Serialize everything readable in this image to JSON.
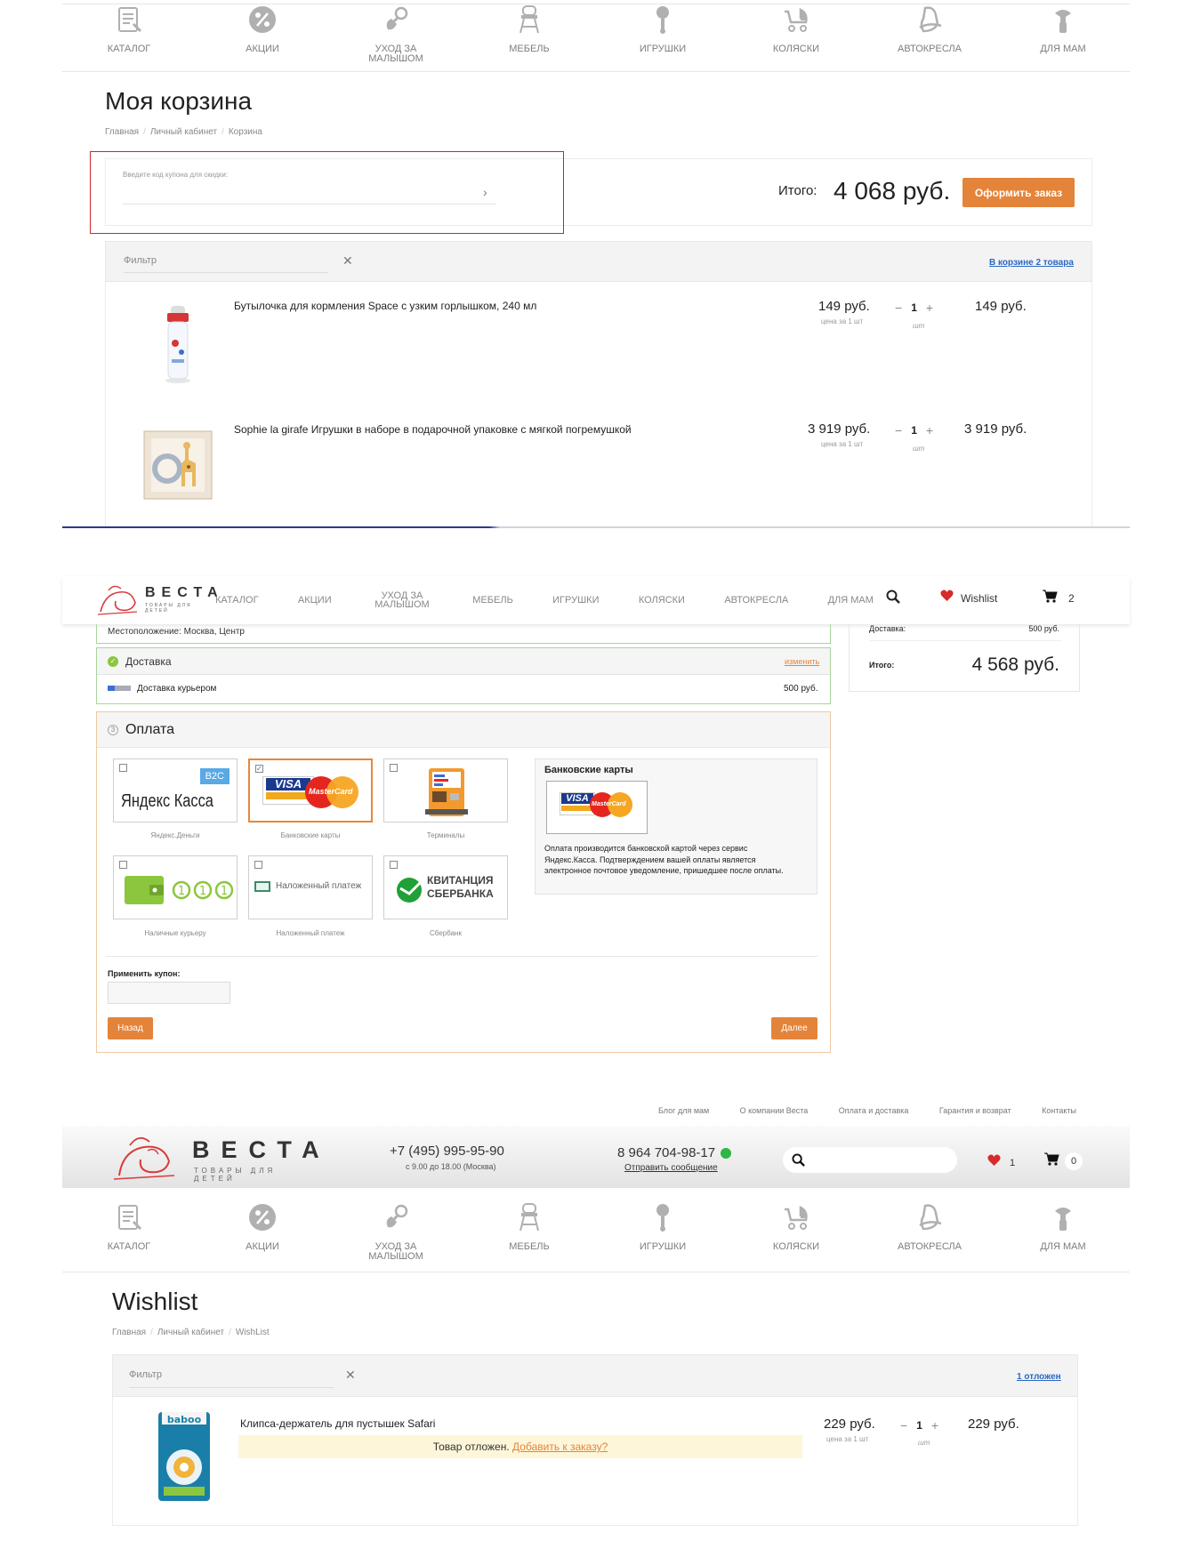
{
  "nav_categories": [
    {
      "label": "КАТАЛОГ",
      "icon": "catalog-icon"
    },
    {
      "label": "АКЦИИ",
      "icon": "percent-icon"
    },
    {
      "label": "УХОД ЗА МАЛЫШОМ",
      "icon": "pacifier-icon"
    },
    {
      "label": "МЕБЕЛЬ",
      "icon": "high-chair-icon"
    },
    {
      "label": "ИГРУШКИ",
      "icon": "rattle-icon"
    },
    {
      "label": "КОЛЯСКИ",
      "icon": "stroller-icon"
    },
    {
      "label": "АВТОКРЕСЛА",
      "icon": "car-seat-icon"
    },
    {
      "label": "ДЛЯ МАМ",
      "icon": "breast-pump-icon"
    }
  ],
  "cart": {
    "title": "Моя корзина",
    "breadcrumbs": [
      "Главная",
      "Личный кабинет",
      "Корзина"
    ],
    "coupon_placeholder": "Введите код купона для скидки:",
    "total_label": "Итого:",
    "total_value": "4 068 руб.",
    "checkout_button": "Оформить заказ",
    "filter_placeholder": "Фильтр",
    "items_count": "В корзине 2 товара",
    "items": [
      {
        "name": "Бутылочка для кормления Space с узким горлышком, 240 мл",
        "price": "149 руб.",
        "unit": "цена за 1 шт",
        "qty": "1",
        "qty_unit": "шт",
        "sum": "149 руб."
      },
      {
        "name": "Sophie la girafe Игрушки в наборе в подарочной упаковке с мягкой погремушкой",
        "price": "3 919 руб.",
        "unit": "цена за 1 шт",
        "qty": "1",
        "qty_unit": "шт",
        "sum": "3 919 руб."
      }
    ]
  },
  "sticky_header": {
    "logo_text": "ВЕСТА",
    "logo_sub": "ТОВАРЫ ДЛЯ ДЕТЕЙ",
    "menu": [
      "КАТАЛОГ",
      "АКЦИИ",
      "УХОД ЗА МАЛЫШОМ",
      "МЕБЕЛЬ",
      "ИГРУШКИ",
      "КОЛЯСКИ",
      "АВТОКРЕСЛА",
      "ДЛЯ МАМ"
    ],
    "wishlist": "Wishlist",
    "cart_count": "2"
  },
  "checkout": {
    "location": "Местоположение: Москва, Центр",
    "delivery_title": "Доставка",
    "change_link": "изменить",
    "delivery_method": "Доставка курьером",
    "delivery_price": "500 руб.",
    "payment_num": "3",
    "payment_title": "Оплата",
    "payment_methods": [
      {
        "caption": "Яндекс.Деньги",
        "logo": "Яндекс Касса",
        "badge": "B2C"
      },
      {
        "caption": "Банковские карты",
        "logo": "VISA MasterCard"
      },
      {
        "caption": "Терминалы",
        "logo": "terminal"
      },
      {
        "caption": "Наличные курьеру",
        "logo": "cash"
      },
      {
        "caption": "Наложенный платеж",
        "logo": "Наложенный платеж"
      },
      {
        "caption": "Сбербанк",
        "logo": "КВИТАНЦИЯ СБЕРБАНКА"
      }
    ],
    "info_title": "Банковские карты",
    "info_text": "Оплата производится банковской картой через сервис Яндекс.Касса. Подтверждением вашей оплаты является электронное почтовое уведомление, пришедшее после оплаты.",
    "coupon_label": "Применить купон:",
    "back_button": "Назад",
    "next_button": "Далее",
    "summary_delivery_label": "Доставка:",
    "summary_delivery_value": "500 руб.",
    "summary_total_label": "Итого:",
    "summary_total_value": "4 568 руб."
  },
  "site_header": {
    "top_links": [
      "Блог для мам",
      "О компании Веста",
      "Оплата и доставка",
      "Гарантия и возврат",
      "Контакты"
    ],
    "logo_text": "ВЕСТА",
    "logo_sub": "ТОВАРЫ ДЛЯ ДЕТЕЙ",
    "phone1": "+7 (495) 995-95-90",
    "phone1_hours": "с 9.00 до 18.00 (Москва)",
    "phone2": "8 964 704-98-17",
    "phone2_link": "Отправить сообщение",
    "wishlist_count": "1",
    "cart_count": "0"
  },
  "wishlist": {
    "title": "Wishlist",
    "breadcrumbs": [
      "Главная",
      "Личный кабинет",
      "WishList"
    ],
    "filter_placeholder": "Фильтр",
    "count": "1 отложен",
    "item": {
      "name": "Клипса-держатель для пустышек Safari",
      "price": "229 руб.",
      "unit": "цена за 1 шт",
      "qty": "1",
      "qty_unit": "шт",
      "sum": "229 руб.",
      "notice": "Товар отложен.",
      "notice_link": "Добавить к заказу?"
    }
  },
  "colors": {
    "accent": "#e4843a",
    "link": "#2a68c5",
    "red": "#d72a2a",
    "green": "#8cc63f"
  }
}
